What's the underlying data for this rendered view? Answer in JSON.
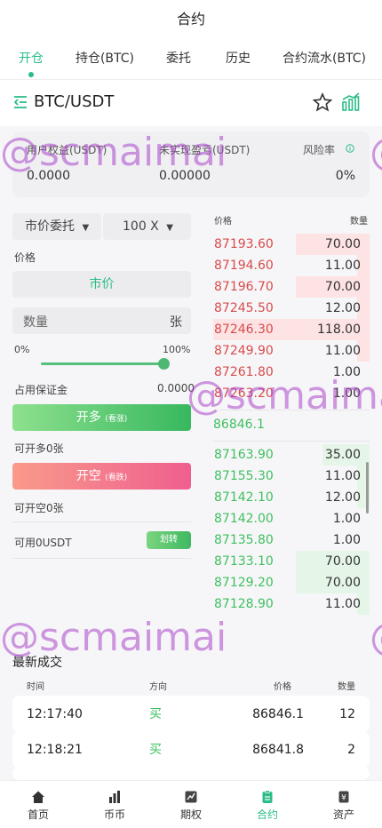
{
  "header": {
    "title": "合约"
  },
  "tabs": [
    {
      "label": "开仓",
      "active": true
    },
    {
      "label": "持仓(BTC)"
    },
    {
      "label": "委托"
    },
    {
      "label": "历史"
    },
    {
      "label": "合约流水(BTC)"
    }
  ],
  "pair": {
    "name": "BTC/USDT"
  },
  "equity": {
    "user_equity_label": "用户权益(USDT)",
    "user_equity_value": "0.0000",
    "unrealized_label": "未实现盈亏(USDT)",
    "unrealized_value": "0.00000",
    "risk_label": "风险率",
    "risk_value": "0%"
  },
  "form": {
    "order_type": "市价委托",
    "leverage": "100 X",
    "price_label": "价格",
    "price_value": "市价",
    "qty_placeholder": "数量",
    "qty_unit": "张",
    "slider_min": "0%",
    "slider_max": "100%",
    "slider_value": 1.0,
    "margin_label": "占用保证金",
    "margin_value": "0.0000",
    "long_button": "开多",
    "long_tag": "(看涨)",
    "long_available": "可开多0张",
    "short_button": "开空",
    "short_tag": "(看跌)",
    "short_available": "可开空0张",
    "available": "可用0USDT",
    "transfer_button": "划转"
  },
  "orderbook": {
    "price_header": "价格",
    "qty_header": "数量",
    "asks": [
      {
        "price": "87193.60",
        "qty": "70.00",
        "depth": 0.47
      },
      {
        "price": "87194.60",
        "qty": "11.00",
        "depth": 0.08
      },
      {
        "price": "87196.70",
        "qty": "70.00",
        "depth": 0.47
      },
      {
        "price": "87245.50",
        "qty": "12.00",
        "depth": 0.08
      },
      {
        "price": "87246.30",
        "qty": "118.00",
        "depth": 1.0
      },
      {
        "price": "87249.90",
        "qty": "11.00",
        "depth": 0.08
      },
      {
        "price": "87261.80",
        "qty": "1.00",
        "depth": 0.0
      },
      {
        "price": "87263.20",
        "qty": "1.00",
        "depth": 0.0
      }
    ],
    "mid_price": "86846.1",
    "bids": [
      {
        "price": "87163.90",
        "qty": "35.00",
        "depth": 0.3
      },
      {
        "price": "87155.30",
        "qty": "11.00",
        "depth": 0.08
      },
      {
        "price": "87142.10",
        "qty": "12.00",
        "depth": 0.08
      },
      {
        "price": "87142.00",
        "qty": "1.00",
        "depth": 0.0
      },
      {
        "price": "87135.80",
        "qty": "1.00",
        "depth": 0.0
      },
      {
        "price": "87133.10",
        "qty": "70.00",
        "depth": 0.47
      },
      {
        "price": "87129.20",
        "qty": "70.00",
        "depth": 0.47
      },
      {
        "price": "87128.90",
        "qty": "11.00",
        "depth": 0.08
      }
    ]
  },
  "trades": {
    "title": "最新成交",
    "headers": {
      "time": "时间",
      "side": "方向",
      "price": "价格",
      "qty": "数量"
    },
    "rows": [
      {
        "time": "12:17:40",
        "side": "买",
        "price": "86846.1",
        "qty": "12"
      },
      {
        "time": "12:18:21",
        "side": "买",
        "price": "86841.8",
        "qty": "2"
      }
    ]
  },
  "nav": [
    {
      "label": "首页",
      "icon": "home-icon"
    },
    {
      "label": "币币",
      "icon": "bar-chart-icon"
    },
    {
      "label": "期权",
      "icon": "options-icon"
    },
    {
      "label": "合约",
      "icon": "contract-icon",
      "active": true
    },
    {
      "label": "资产",
      "icon": "wallet-icon"
    }
  ],
  "watermark": "@scmaimai",
  "colors": {
    "accent": "#2bbd87",
    "ask": "#d94b4b",
    "bid": "#3fbf5f",
    "watermark": "#aa46c8"
  }
}
